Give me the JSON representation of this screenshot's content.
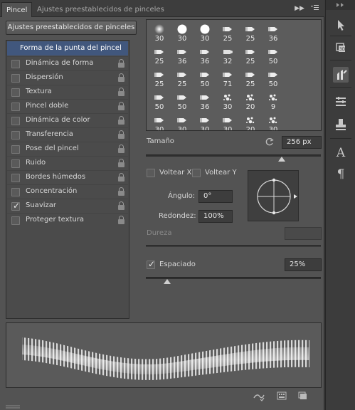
{
  "tabs": {
    "active": "Pincel",
    "inactive": "Ajustes preestablecidos de pinceles",
    "expand_icon": "double-chevron-right-icon",
    "menu_icon": "panel-menu-icon"
  },
  "preset_button": "Ajustes preestablecidos de pinceles",
  "tip_shape_header": "Forma de la punta del pincel",
  "options": [
    {
      "label": "Dinámica de forma",
      "checked": false
    },
    {
      "label": "Dispersión",
      "checked": false
    },
    {
      "label": "Textura",
      "checked": false
    },
    {
      "label": "Pincel doble",
      "checked": false
    },
    {
      "label": "Dinámica de color",
      "checked": false
    },
    {
      "label": "Transferencia",
      "checked": false
    },
    {
      "label": "Pose del pincel",
      "checked": false
    },
    {
      "label": "Ruido",
      "checked": false
    },
    {
      "label": "Bordes húmedos",
      "checked": false
    },
    {
      "label": "Concentración",
      "checked": false
    },
    {
      "label": "Suavizar",
      "checked": true
    },
    {
      "label": "Proteger textura",
      "checked": false
    }
  ],
  "brush_tips": [
    [
      "30",
      "30",
      "30",
      "25",
      "25",
      "36"
    ],
    [
      "25",
      "36",
      "36",
      "32",
      "25",
      "50"
    ],
    [
      "25",
      "25",
      "50",
      "71",
      "25",
      "50"
    ],
    [
      "50",
      "50",
      "36",
      "30",
      "20",
      "9"
    ],
    [
      "30",
      "30",
      "30",
      "30",
      "20",
      "30"
    ]
  ],
  "size": {
    "label": "Tamaño",
    "value": "256 px",
    "reset_icon": "reset-icon"
  },
  "flip_x": {
    "label": "Voltear X",
    "checked": false
  },
  "flip_y": {
    "label": "Voltear Y",
    "checked": false
  },
  "angle": {
    "label": "Ángulo:",
    "value": "0°"
  },
  "roundness": {
    "label": "Redondez:",
    "value": "100%"
  },
  "hardness": {
    "label": "Dureza"
  },
  "spacing": {
    "label": "Espaciado",
    "checked": true,
    "value": "25%"
  },
  "dock_icons": [
    "arrow-icon",
    "layers-3d-icon",
    "brush-panel-icon",
    "properties-icon",
    "stamp-icon",
    "character-icon",
    "paragraph-icon"
  ],
  "bottom_icons": [
    "toggle-preview-icon",
    "grid-icon",
    "new-brush-icon"
  ],
  "colors": {
    "selection": "#41577d",
    "panel": "#535353"
  }
}
